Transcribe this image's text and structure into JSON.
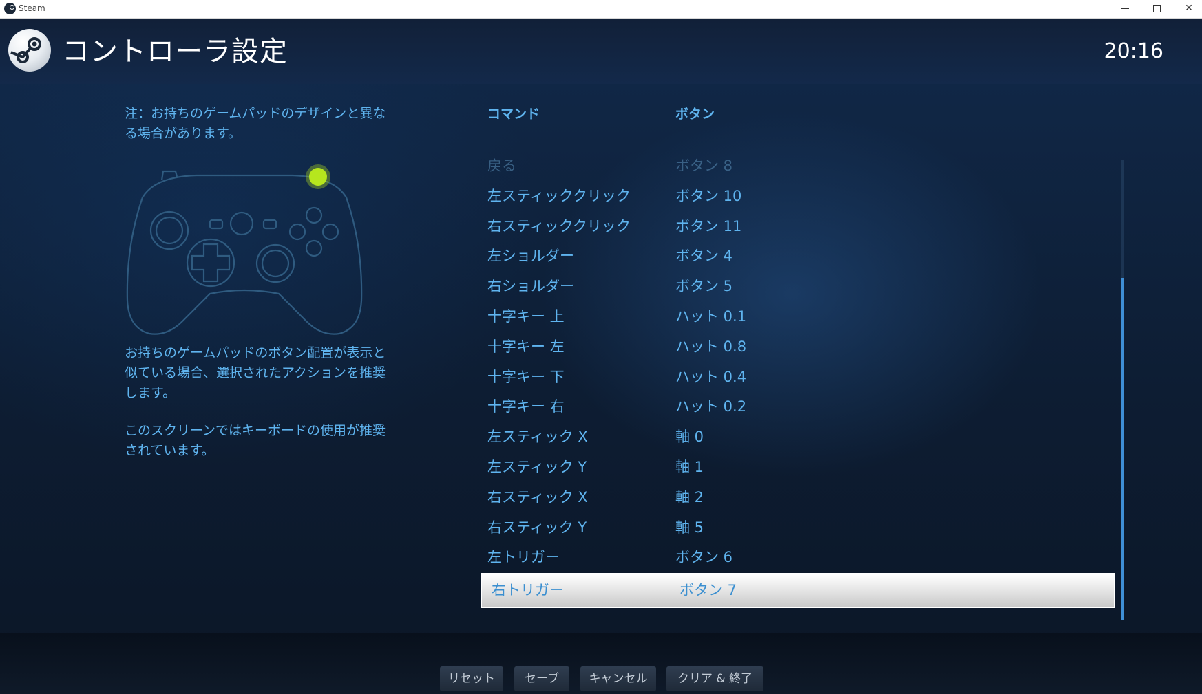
{
  "window": {
    "title": "Steam"
  },
  "header": {
    "title": "コントローラ設定",
    "clock": "20:16"
  },
  "left_panel": {
    "note": "注：お持ちのゲームパッドのデザインと異なる場合があります。",
    "help_1": "お持ちのゲームパッドのボタン配置が表示と似ている場合、選択されたアクションを推奨します。",
    "help_2": "このスクリーンではキーボードの使用が推奨されています。",
    "gamepad_highlight_color": "#b6e61e"
  },
  "table": {
    "headers": {
      "command": "コマンド",
      "button": "ボタン"
    },
    "rows": [
      {
        "command": "戻る",
        "button": "ボタン 8"
      },
      {
        "command": "左スティッククリック",
        "button": "ボタン 10"
      },
      {
        "command": "右スティッククリック",
        "button": "ボタン 11"
      },
      {
        "command": "左ショルダー",
        "button": "ボタン 4"
      },
      {
        "command": "右ショルダー",
        "button": "ボタン 5"
      },
      {
        "command": "十字キー 上",
        "button": "ハット 0.1"
      },
      {
        "command": "十字キー 左",
        "button": "ハット 0.8"
      },
      {
        "command": "十字キー 下",
        "button": "ハット 0.4"
      },
      {
        "command": "十字キー 右",
        "button": "ハット 0.2"
      },
      {
        "command": "左スティック X",
        "button": "軸 0"
      },
      {
        "command": "左スティック Y",
        "button": "軸 1"
      },
      {
        "command": "右スティック X",
        "button": "軸 2"
      },
      {
        "command": "右スティック Y",
        "button": "軸 5"
      },
      {
        "command": "左トリガー",
        "button": "ボタン 6"
      },
      {
        "command": "右トリガー",
        "button": "ボタン 7"
      }
    ]
  },
  "footer": {
    "reset": "リセット",
    "save": "セーブ",
    "cancel": "キャンセル",
    "clear_exit": "クリア & 終了"
  },
  "colors": {
    "accent": "#5fb4ef",
    "scroll_thumb": "#3f8fd6"
  }
}
